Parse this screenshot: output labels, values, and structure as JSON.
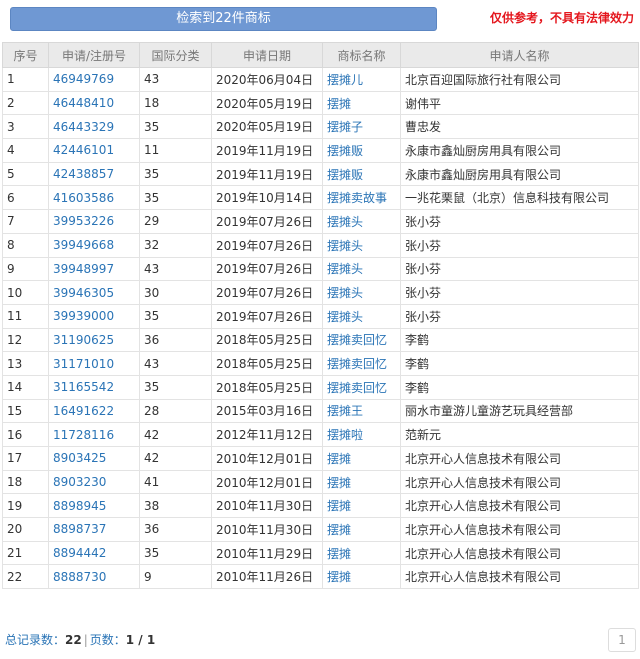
{
  "header": {
    "search_button": "检索到22件商标",
    "disclaimer": "仅供参考，不具有法律效力"
  },
  "table": {
    "columns": [
      "序号",
      "申请/注册号",
      "国际分类",
      "申请日期",
      "商标名称",
      "申请人名称"
    ],
    "rows": [
      [
        "1",
        "46949769",
        "43",
        "2020年06月04日",
        "摆摊儿",
        "北京百迎国际旅行社有限公司"
      ],
      [
        "2",
        "46448410",
        "18",
        "2020年05月19日",
        "摆摊",
        "谢伟平"
      ],
      [
        "3",
        "46443329",
        "35",
        "2020年05月19日",
        "摆摊子",
        "曹忠发"
      ],
      [
        "4",
        "42446101",
        "11",
        "2019年11月19日",
        "摆摊贩",
        "永康市鑫灿厨房用具有限公司"
      ],
      [
        "5",
        "42438857",
        "35",
        "2019年11月19日",
        "摆摊贩",
        "永康市鑫灿厨房用具有限公司"
      ],
      [
        "6",
        "41603586",
        "35",
        "2019年10月14日",
        "摆摊卖故事",
        "一兆花栗鼠（北京）信息科技有限公司"
      ],
      [
        "7",
        "39953226",
        "29",
        "2019年07月26日",
        "摆摊头",
        "张小芬"
      ],
      [
        "8",
        "39949668",
        "32",
        "2019年07月26日",
        "摆摊头",
        "张小芬"
      ],
      [
        "9",
        "39948997",
        "43",
        "2019年07月26日",
        "摆摊头",
        "张小芬"
      ],
      [
        "10",
        "39946305",
        "30",
        "2019年07月26日",
        "摆摊头",
        "张小芬"
      ],
      [
        "11",
        "39939000",
        "35",
        "2019年07月26日",
        "摆摊头",
        "张小芬"
      ],
      [
        "12",
        "31190625",
        "36",
        "2018年05月25日",
        "摆摊卖回忆",
        "李鹤"
      ],
      [
        "13",
        "31171010",
        "43",
        "2018年05月25日",
        "摆摊卖回忆",
        "李鹤"
      ],
      [
        "14",
        "31165542",
        "35",
        "2018年05月25日",
        "摆摊卖回忆",
        "李鹤"
      ],
      [
        "15",
        "16491622",
        "28",
        "2015年03月16日",
        "摆摊王",
        "丽水市童游儿童游艺玩具经营部"
      ],
      [
        "16",
        "11728116",
        "42",
        "2012年11月12日",
        "摆摊啦",
        "范新元"
      ],
      [
        "17",
        "8903425",
        "42",
        "2010年12月01日",
        "摆摊",
        "北京开心人信息技术有限公司"
      ],
      [
        "18",
        "8903230",
        "41",
        "2010年12月01日",
        "摆摊",
        "北京开心人信息技术有限公司"
      ],
      [
        "19",
        "8898945",
        "38",
        "2010年11月30日",
        "摆摊",
        "北京开心人信息技术有限公司"
      ],
      [
        "20",
        "8898737",
        "36",
        "2010年11月30日",
        "摆摊",
        "北京开心人信息技术有限公司"
      ],
      [
        "21",
        "8894442",
        "35",
        "2010年11月29日",
        "摆摊",
        "北京开心人信息技术有限公司"
      ],
      [
        "22",
        "8888730",
        "9",
        "2010年11月26日",
        "摆摊",
        "北京开心人信息技术有限公司"
      ]
    ]
  },
  "footer": {
    "total_label": "总记录数：",
    "total_value": "22",
    "separator": "|",
    "pages_label": "页数：",
    "pages_value": "1 / 1",
    "page_button": "1"
  },
  "colors": {
    "accent": "#6f98d3",
    "link": "#2a74b6",
    "warning": "#e4161d",
    "header_bg": "#eaeaea"
  }
}
